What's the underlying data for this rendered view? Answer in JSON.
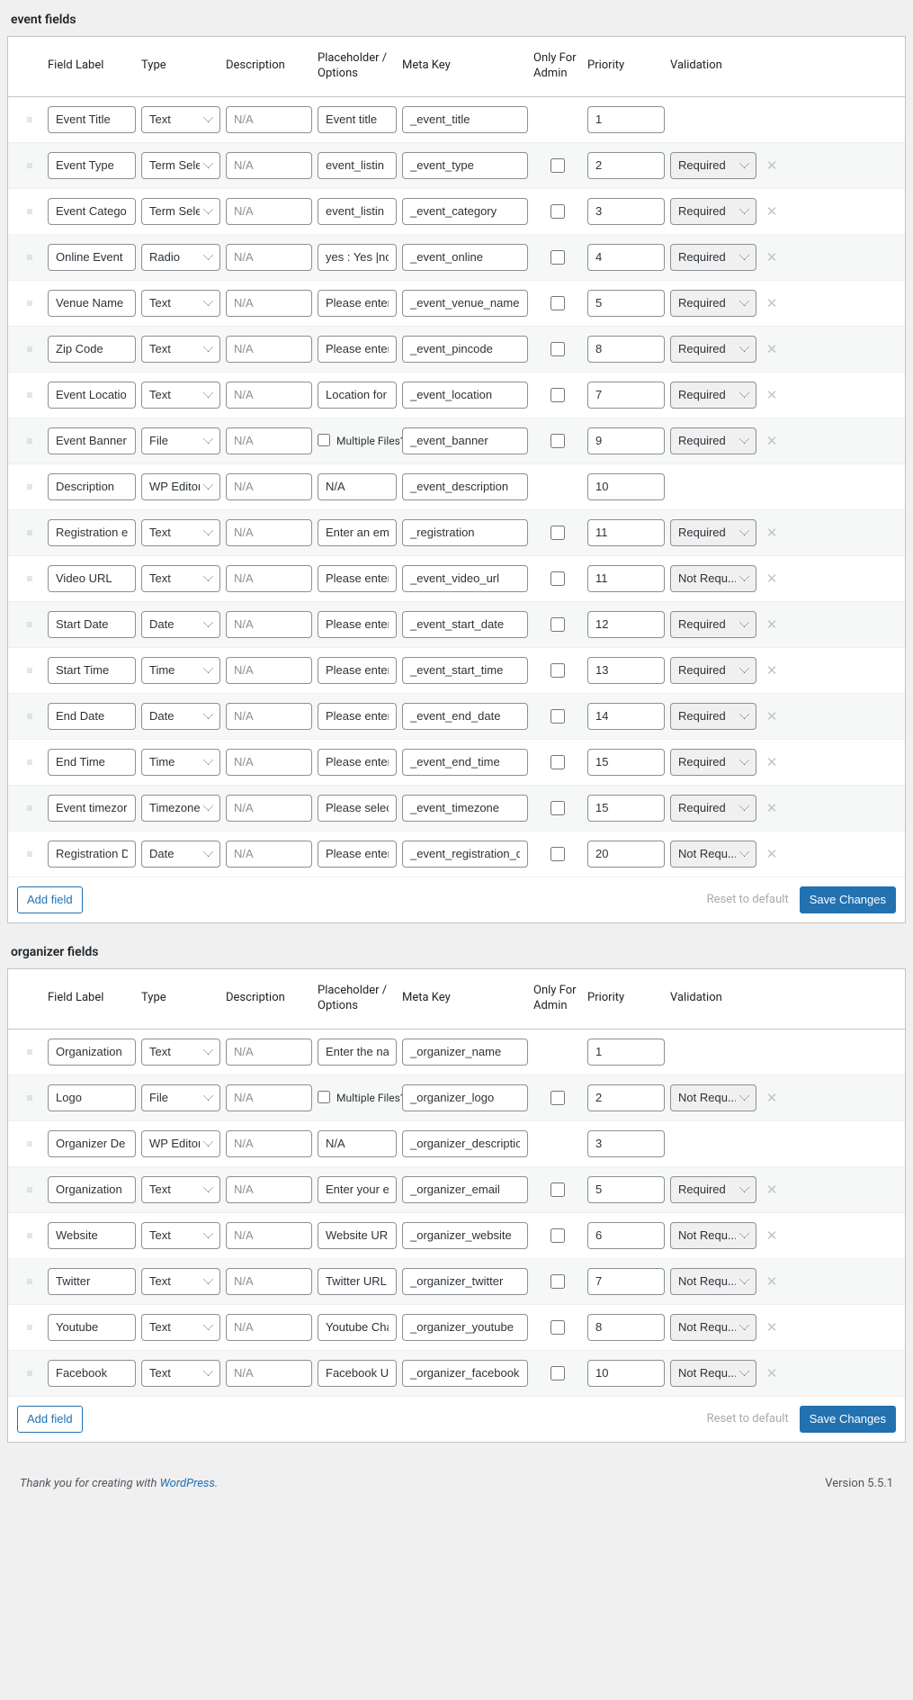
{
  "header": {
    "label": "Field Label",
    "type": "Type",
    "desc": "Description",
    "ph": "Placeholder / Options",
    "meta": "Meta Key",
    "admin": "Only For Admin",
    "prio": "Priority",
    "valid": "Validation"
  },
  "type_options": [
    "Text",
    "Term Select",
    "Radio",
    "File",
    "WP Editor",
    "Date",
    "Time",
    "Timezone"
  ],
  "validation_options": [
    "Required",
    "Not Requ..."
  ],
  "multiple_files": "Multiple Files?",
  "na": "N/A",
  "buttons": {
    "add": "Add field",
    "reset": "Reset to default",
    "save": "Save Changes"
  },
  "footer": {
    "thanks": "Thank you for creating with ",
    "link": "WordPress",
    "version": "Version 5.5.1"
  },
  "sections": [
    {
      "title": "event fields",
      "rows": [
        {
          "label": "Event Title",
          "type": "Text",
          "ph": "Event title",
          "meta": "_event_title",
          "admin": null,
          "prio": "1",
          "valid": null,
          "del": false
        },
        {
          "label": "Event Type",
          "type": "Term Select",
          "ph": "event_listin",
          "meta": "_event_type",
          "admin": false,
          "prio": "2",
          "valid": "Required",
          "del": true
        },
        {
          "label": "Event Catego",
          "type": "Term Select",
          "ph": "event_listin",
          "meta": "_event_category",
          "admin": false,
          "prio": "3",
          "valid": "Required",
          "del": true
        },
        {
          "label": "Online Event",
          "type": "Radio",
          "ph": "yes : Yes |no :",
          "meta": "_event_online",
          "admin": false,
          "prio": "4",
          "valid": "Required",
          "del": true
        },
        {
          "label": "Venue Name",
          "type": "Text",
          "ph": "Please enter t",
          "meta": "_event_venue_name",
          "admin": false,
          "prio": "5",
          "valid": "Required",
          "del": true
        },
        {
          "label": "Zip Code",
          "type": "Text",
          "ph": "Please enter z",
          "meta": "_event_pincode",
          "admin": false,
          "prio": "8",
          "valid": "Required",
          "del": true
        },
        {
          "label": "Event Locatio",
          "type": "Text",
          "ph": "Location for g",
          "meta": "_event_location",
          "admin": false,
          "prio": "7",
          "valid": "Required",
          "del": true
        },
        {
          "label": "Event Banner",
          "type": "File",
          "ph": "__multi__",
          "meta": "_event_banner",
          "admin": false,
          "prio": "9",
          "valid": "Required",
          "del": true
        },
        {
          "label": "Description",
          "type": "WP Editor",
          "ph": "N/A",
          "meta": "_event_description",
          "admin": null,
          "prio": "10",
          "valid": null,
          "del": false
        },
        {
          "label": "Registration e",
          "type": "Text",
          "ph": "Enter an emai",
          "meta": "_registration",
          "admin": false,
          "prio": "11",
          "valid": "Required",
          "del": true
        },
        {
          "label": "Video URL",
          "type": "Text",
          "ph": "Please enter e",
          "meta": "_event_video_url",
          "admin": false,
          "prio": "11",
          "valid": "Not Requ...",
          "del": true
        },
        {
          "label": "Start Date",
          "type": "Date",
          "ph": "Please enter e",
          "meta": "_event_start_date",
          "admin": false,
          "prio": "12",
          "valid": "Required",
          "del": true
        },
        {
          "label": "Start Time",
          "type": "Time",
          "ph": "Please enter e",
          "meta": "_event_start_time",
          "admin": false,
          "prio": "13",
          "valid": "Required",
          "del": true
        },
        {
          "label": "End Date",
          "type": "Date",
          "ph": "Please enter e",
          "meta": "_event_end_date",
          "admin": false,
          "prio": "14",
          "valid": "Required",
          "del": true
        },
        {
          "label": "End Time",
          "type": "Time",
          "ph": "Please enter e",
          "meta": "_event_end_time",
          "admin": false,
          "prio": "15",
          "valid": "Required",
          "del": true
        },
        {
          "label": "Event timezor",
          "type": "Timezone",
          "ph": "Please select t",
          "meta": "_event_timezone",
          "admin": false,
          "prio": "15",
          "valid": "Required",
          "del": true
        },
        {
          "label": "Registration D",
          "type": "Date",
          "ph": "Please enter r",
          "meta": "_event_registration_deac",
          "admin": false,
          "prio": "20",
          "valid": "Not Requ...",
          "del": true
        }
      ]
    },
    {
      "title": "organizer fields",
      "rows": [
        {
          "label": "Organization",
          "type": "Text",
          "ph": "Enter the nam",
          "meta": "_organizer_name",
          "admin": null,
          "prio": "1",
          "valid": null,
          "del": false
        },
        {
          "label": "Logo",
          "type": "File",
          "ph": "__multi__",
          "meta": "_organizer_logo",
          "admin": false,
          "prio": "2",
          "valid": "Not Requ...",
          "del": true
        },
        {
          "label": "Organizer De",
          "type": "WP Editor",
          "ph": "N/A",
          "meta": "_organizer_description",
          "admin": null,
          "prio": "3",
          "valid": null,
          "del": false
        },
        {
          "label": "Organization",
          "type": "Text",
          "ph": "Enter your em",
          "meta": "_organizer_email",
          "admin": false,
          "prio": "5",
          "valid": "Required",
          "del": true
        },
        {
          "label": "Website",
          "type": "Text",
          "ph": "Website URL",
          "meta": "_organizer_website",
          "admin": false,
          "prio": "6",
          "valid": "Not Requ...",
          "del": true
        },
        {
          "label": "Twitter",
          "type": "Text",
          "ph": "Twitter URL e.",
          "meta": "_organizer_twitter",
          "admin": false,
          "prio": "7",
          "valid": "Not Requ...",
          "del": true
        },
        {
          "label": "Youtube",
          "type": "Text",
          "ph": "Youtube Char",
          "meta": "_organizer_youtube",
          "admin": false,
          "prio": "8",
          "valid": "Not Requ...",
          "del": true
        },
        {
          "label": "Facebook",
          "type": "Text",
          "ph": "Facebook URL",
          "meta": "_organizer_facebook",
          "admin": false,
          "prio": "10",
          "valid": "Not Requ...",
          "del": true
        }
      ]
    }
  ]
}
